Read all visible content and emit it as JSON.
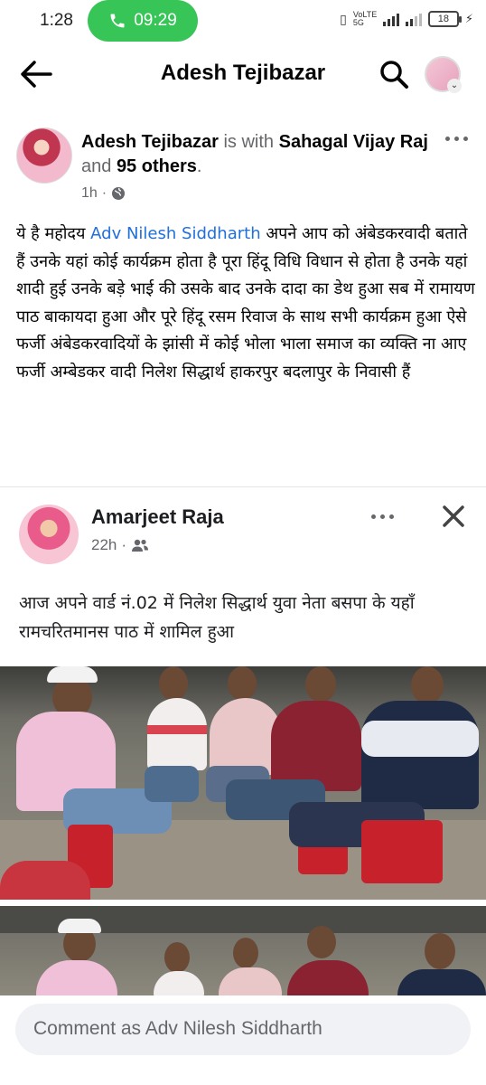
{
  "status_bar": {
    "time": "1:28",
    "call_time": "09:29",
    "network_label": "VoLTE 5G",
    "battery": "18"
  },
  "header": {
    "title": "Adesh Tejibazar"
  },
  "post": {
    "author": "Adesh Tejibazar",
    "with_text": "is with",
    "tagged": "Sahagal Vijay Raj",
    "and_text": "and",
    "others": "95 others",
    "period": ".",
    "time": "1h",
    "body_before_mention": "ये है महोदय",
    "mention": "Adv Nilesh Siddharth",
    "body_after_mention": "अपने आप को अंबेडकरवादी बताते हैं  उनके यहां कोई कार्यक्रम होता है पूरा हिंदू विधि विधान से होता है उनके यहां शादी हुई उनके बड़े भाई की उसके बाद उनके दादा का डेथ हुआ सब में रामायण पाठ बाकायदा हुआ और पूरे हिंदू रसम रिवाज के साथ सभी कार्यक्रम हुआ ऐसे फर्जी अंबेडकरवादियों के झांसी में कोई भोला भाला समाज का व्यक्ति ना आए फर्जी अम्बेडकर वादी निलेश सिद्धार्थ हाकरपुर बदलापुर के निवासी हैं"
  },
  "shared_post": {
    "author": "Amarjeet Raja",
    "time": "22h",
    "text": "आज अपने वार्ड नं.02 में निलेश सिद्धार्थ युवा नेता बसपा के यहाँ रामचरितमानस पाठ में शामिल हुआ"
  },
  "comment": {
    "placeholder": "Comment as Adv Nilesh Siddharth"
  },
  "colors": {
    "call_green": "#37c558",
    "mention_blue": "#216fdb",
    "meta_gray": "#65676b"
  }
}
